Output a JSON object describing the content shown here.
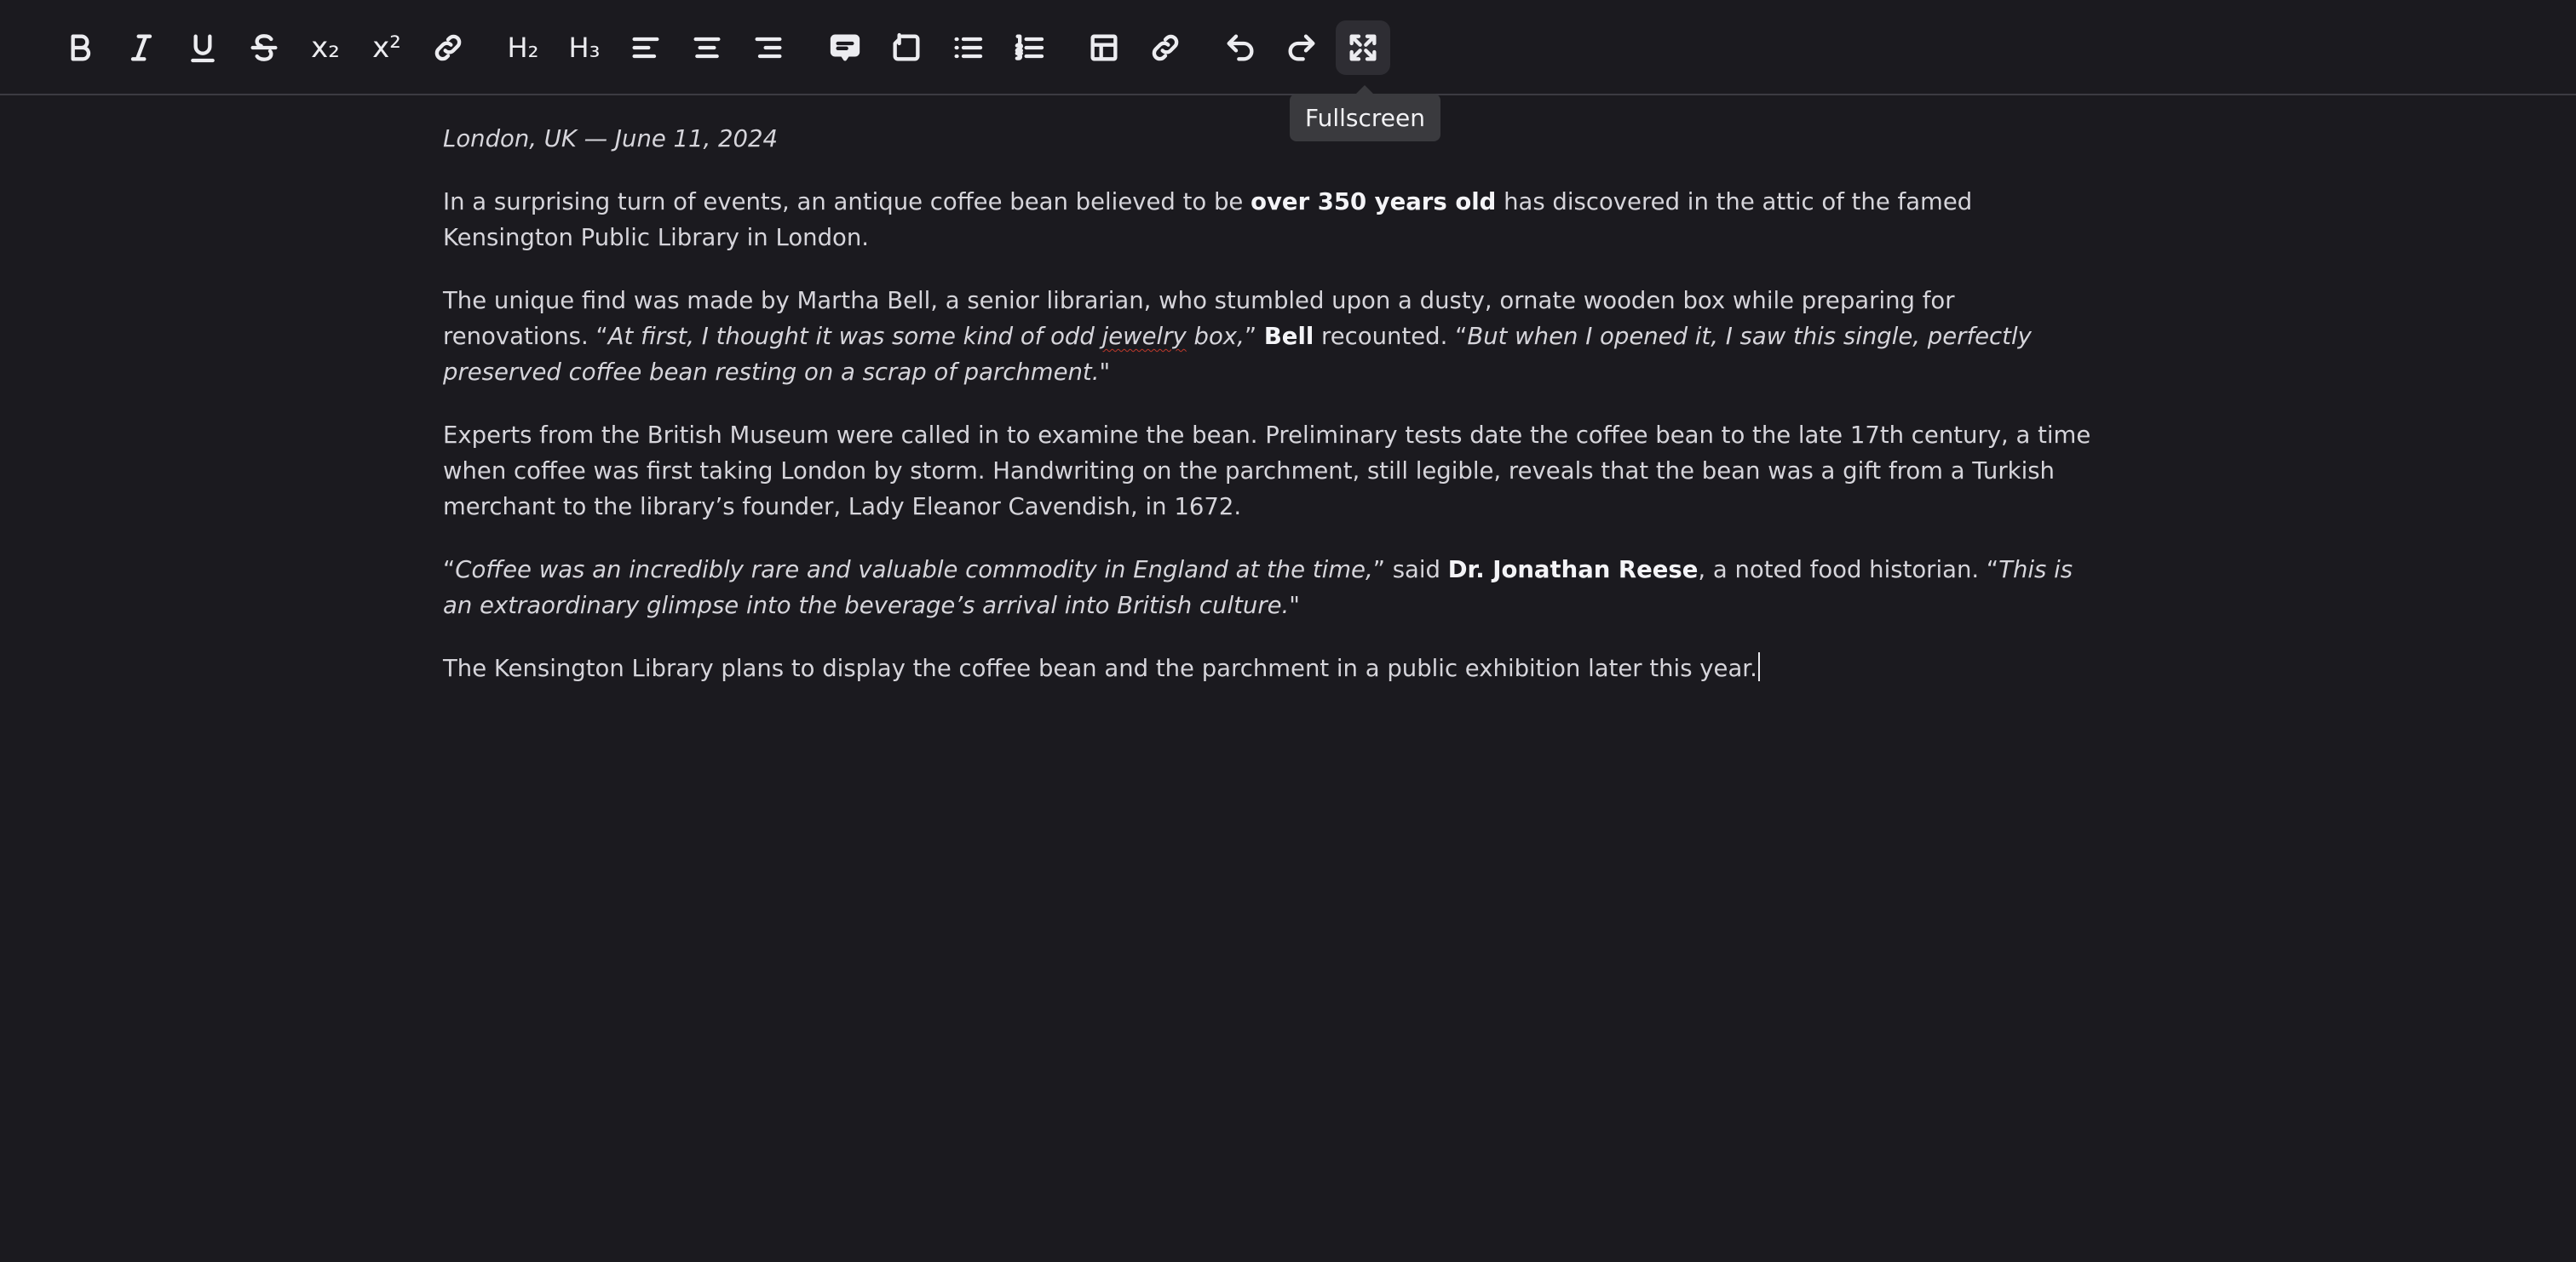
{
  "toolbar": {
    "buttons": [
      {
        "name": "bold",
        "icon": "bold-icon"
      },
      {
        "name": "italic",
        "icon": "italic-icon"
      },
      {
        "name": "underline",
        "icon": "underline-icon"
      },
      {
        "name": "strikethrough",
        "icon": "strikethrough-icon"
      },
      {
        "name": "subscript",
        "icon": "subscript-icon"
      },
      {
        "name": "superscript",
        "icon": "superscript-icon"
      },
      {
        "name": "link",
        "icon": "link-icon"
      },
      {
        "name": "heading-2",
        "icon": "heading-2-icon"
      },
      {
        "name": "heading-3",
        "icon": "heading-3-icon"
      },
      {
        "name": "align-left",
        "icon": "align-left-icon"
      },
      {
        "name": "align-center",
        "icon": "align-center-icon"
      },
      {
        "name": "align-right",
        "icon": "align-right-icon"
      },
      {
        "name": "comment",
        "icon": "comment-icon"
      },
      {
        "name": "rotate",
        "icon": "rotate-icon"
      },
      {
        "name": "bullet-list",
        "icon": "bullet-list-icon"
      },
      {
        "name": "numbered-list",
        "icon": "numbered-list-icon"
      },
      {
        "name": "table",
        "icon": "table-icon"
      },
      {
        "name": "link-2",
        "icon": "link-icon"
      },
      {
        "name": "undo",
        "icon": "undo-icon"
      },
      {
        "name": "redo",
        "icon": "redo-icon"
      },
      {
        "name": "fullscreen",
        "icon": "fullscreen-icon",
        "hovered": true
      }
    ],
    "subscript_glyph": "x₂",
    "superscript_glyph": "x²",
    "h2_glyph": "H₂",
    "h3_glyph": "H₃",
    "tooltip": "Fullscreen"
  },
  "document": {
    "dateline": "London, UK — June 11, 2024",
    "p1": {
      "a": "In a surprising turn of events, an antique coffee bean believed to be ",
      "bold": "over 350 years old",
      "b": " has discovered in the attic of the famed Kensington Public Library in London."
    },
    "p2": {
      "a": "The unique find was made by Martha Bell, a senior librarian, who stumbled upon a dusty, ornate wooden box while preparing for renovations. “",
      "q1a": "At first, I thought it was some kind of odd ",
      "q1misspelled": "jewelry",
      "q1b": " box,",
      "b": "” ",
      "bold": "Bell",
      "c": " recounted. “",
      "q2": "But when I opened it, I saw this single, perfectly preserved coffee bean resting on a scrap of parchment.",
      "d": "\""
    },
    "p3": "Experts from the British Museum were called in to examine the bean. Preliminary tests date the coffee bean to the late 17th century, a time when coffee was first taking London by storm. Handwriting on the parchment, still legible, reveals that the bean was a gift from a Turkish merchant to the library’s founder, Lady Eleanor Cavendish, in 1672.",
    "p4": {
      "a": "“",
      "q1": "Coffee was an incredibly rare and valuable commodity in England at the time,",
      "b": "” said ",
      "bold": "Dr. Jonathan Reese",
      "c": ", a noted food historian. “",
      "q2": "This is an extraordinary glimpse into the beverage’s arrival into British culture.",
      "d": "\""
    },
    "p5": "The Kensington Library plans to display the coffee bean and the parchment in a public exhibition later this year."
  }
}
